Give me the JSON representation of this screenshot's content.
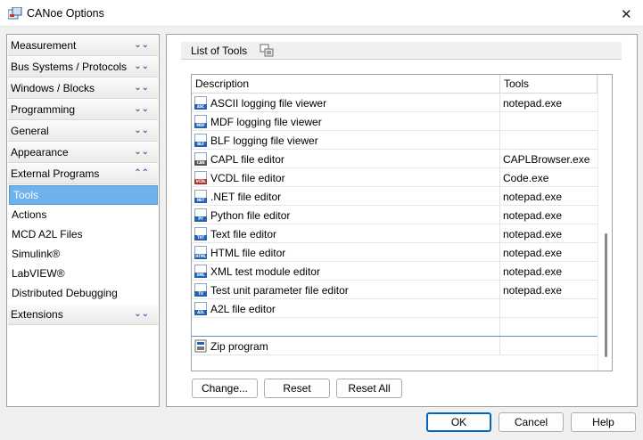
{
  "window": {
    "title": "CANoe Options",
    "close_icon": "close-icon"
  },
  "sidebar": {
    "categories": [
      {
        "label": "Measurement",
        "state": "collapsed"
      },
      {
        "label": "Bus Systems / Protocols",
        "state": "collapsed"
      },
      {
        "label": "Windows / Blocks",
        "state": "collapsed"
      },
      {
        "label": "Programming",
        "state": "collapsed"
      },
      {
        "label": "General",
        "state": "collapsed"
      },
      {
        "label": "Appearance",
        "state": "collapsed"
      },
      {
        "label": "External Programs",
        "state": "expanded"
      },
      {
        "label": "Extensions",
        "state": "collapsed"
      }
    ],
    "subitems": [
      {
        "label": "Tools",
        "selected": true
      },
      {
        "label": "Actions"
      },
      {
        "label": "MCD A2L Files"
      },
      {
        "label": "Simulink®"
      },
      {
        "label": "LabVIEW®"
      },
      {
        "label": "Distributed Debugging"
      }
    ],
    "selected_color": "#6fb1ea"
  },
  "panel": {
    "header": "List of Tools",
    "columns": {
      "description": "Description",
      "tools": "Tools"
    },
    "rows": [
      {
        "icon": "asc",
        "description": "ASCII logging file viewer",
        "tool": "notepad.exe"
      },
      {
        "icon": "mdf",
        "description": "MDF logging file viewer",
        "tool": ""
      },
      {
        "icon": "blf",
        "description": "BLF logging file viewer",
        "tool": ""
      },
      {
        "icon": "can",
        "description": "CAPL file editor",
        "tool": "CAPLBrowser.exe"
      },
      {
        "icon": "vcdl",
        "description": "VCDL file editor",
        "tool": "Code.exe"
      },
      {
        "icon": "net",
        "description": ".NET file editor",
        "tool": "notepad.exe"
      },
      {
        "icon": "py",
        "description": "Python file editor",
        "tool": "notepad.exe"
      },
      {
        "icon": "txt",
        "description": "Text file editor",
        "tool": "notepad.exe"
      },
      {
        "icon": "html",
        "description": "HTML file editor",
        "tool": "notepad.exe"
      },
      {
        "icon": "xml",
        "description": "XML test module editor",
        "tool": "notepad.exe"
      },
      {
        "icon": "tup",
        "description": "Test unit parameter file editor",
        "tool": "notepad.exe"
      },
      {
        "icon": "a2l",
        "description": "A2L file editor",
        "tool": ""
      },
      {
        "icon": "",
        "description": "",
        "tool": ""
      },
      {
        "icon": "zip",
        "description": "Zip program",
        "tool": ""
      }
    ],
    "buttons": {
      "change": "Change...",
      "reset": "Reset",
      "reset_all": "Reset All"
    }
  },
  "footer": {
    "ok": "OK",
    "cancel": "Cancel",
    "help": "Help"
  }
}
